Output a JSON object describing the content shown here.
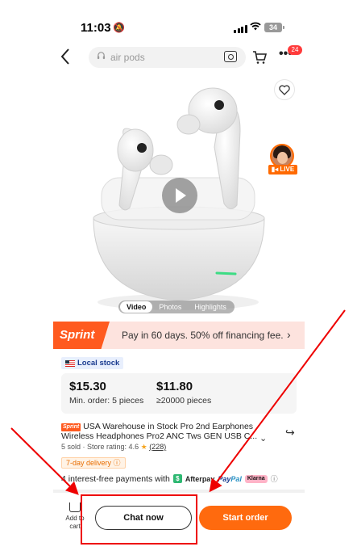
{
  "status_bar": {
    "time": "11:03",
    "battery": "34"
  },
  "search": {
    "placeholder": "air pods"
  },
  "header": {
    "notification_count": "24",
    "more_icon": "more-dots-icon"
  },
  "media": {
    "live_label": "LIVE",
    "tabs": [
      "Video",
      "Photos",
      "Highlights"
    ],
    "active_tab": "Video"
  },
  "promo": {
    "brand": "Sprint",
    "text": "Pay in 60 days. 50% off financing fee."
  },
  "badges": {
    "local_stock": "Local stock"
  },
  "prices": [
    {
      "value": "$15.30",
      "min_order": "Min. order: 5 pieces"
    },
    {
      "value": "$11.80",
      "min_order": "≥20000 pieces"
    }
  ],
  "product": {
    "tag": "Sprint",
    "title": "USA Warehouse in Stock Pro 2nd Earphones Wireless Headphones Pro2 ANC Tws GEN USB C...",
    "sold": "5 sold",
    "store_rating_label": "Store rating: 4.6",
    "review_count": "(228)",
    "delivery": "7-day delivery"
  },
  "payments": {
    "text": "4 interest-free payments with",
    "afterpay": "Afterpay",
    "paypal_a": "Pay",
    "paypal_b": "Pal",
    "klarna": "Klarna"
  },
  "bottom_bar": {
    "add_to_cart": "Add to cart",
    "chat_now": "Chat now",
    "start_order": "Start order"
  },
  "colors": {
    "accent_orange": "#ff6a0e",
    "promo_bg": "#fde3de",
    "annotation_red": "#e00000"
  }
}
